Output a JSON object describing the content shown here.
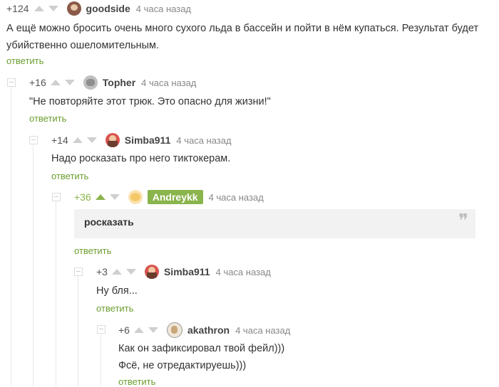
{
  "comments": [
    {
      "rating": "+124",
      "author": "goodside",
      "time": "4 часа назад",
      "lines": [
        "А ещё можно бросить очень много сухого льда в бассейн и пойти в нём купаться. Результат будет",
        "убийственно ошеломительным."
      ],
      "reply": "ответить"
    },
    {
      "rating": "+16",
      "author": "Topher",
      "time": "4 часа назад",
      "lines": [
        "\"Не повторяйте этот трюк. Это опасно для жизни!\""
      ],
      "reply": "ответить"
    },
    {
      "rating": "+14",
      "author": "Simba911",
      "time": "4 часа назад",
      "lines": [
        "Надо росказать про него тиктокерам."
      ],
      "reply": "ответить"
    },
    {
      "rating": "+36",
      "author": "Andreykk",
      "time": "4 часа назад",
      "quote": "росказать",
      "reply": "ответить"
    },
    {
      "rating": "+3",
      "author": "Simba911",
      "time": "4 часа назад",
      "lines": [
        "Ну бля..."
      ],
      "reply": "ответить"
    },
    {
      "rating": "+6",
      "author": "akathron",
      "time": "4 часа назад",
      "lines": [
        "Как он зафиксировал твой фейл)))",
        "Фсё, не отредактируешь)))"
      ],
      "reply": "ответить"
    }
  ],
  "colors": {
    "accent": "#8ab44c",
    "reply_link": "#6b9e2f",
    "quote_bg": "#f2f2f2"
  }
}
